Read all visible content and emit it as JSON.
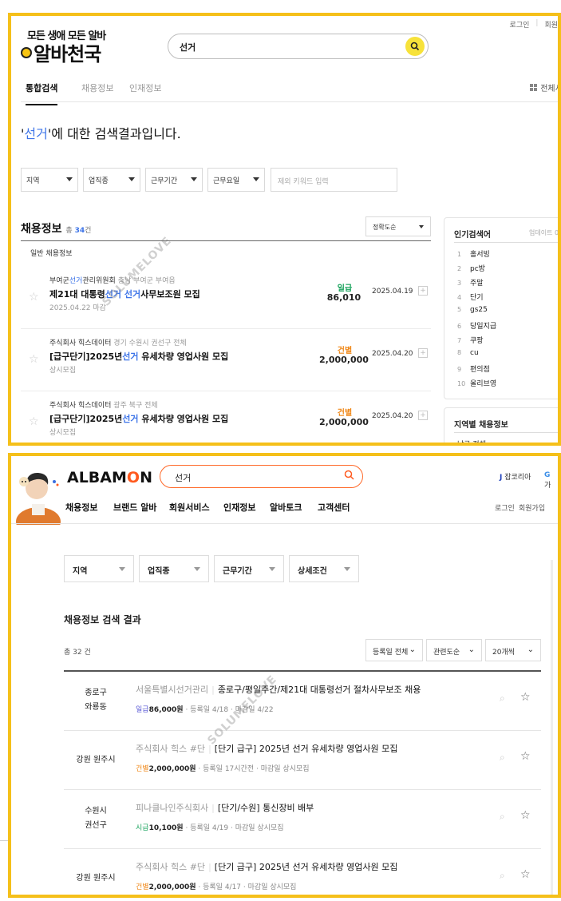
{
  "watermark": "SOLUMELOVE",
  "top": {
    "top_links": [
      "로그인",
      "회원"
    ],
    "logo_tagline": "모든 생애 모든 알바",
    "logo_name": "알바천국",
    "search_query": "선거",
    "tabs": [
      "통합검색",
      "채용정보",
      "인재정보"
    ],
    "tabs_right": "전체서비",
    "result_keyword": "선거",
    "result_suffix": "에 대한 검색결과입니다.",
    "filters": [
      "지역",
      "업직종",
      "근무기간",
      "근무요일"
    ],
    "keyword_placeholder": "제외 키워드 입력",
    "jobs_label": "채용정보",
    "jobs_count_prefix": "총",
    "jobs_count": "34",
    "jobs_count_suffix": "건",
    "sort": "정확도순",
    "general_label": "일반 채용정보",
    "rows": [
      {
        "company_pre": "부여군",
        "company_kw": "선거",
        "company_post": "관리위원회",
        "location": "충남 부여군 부여읍",
        "title_pre": "제21대 대통령",
        "title_kw1": "선거",
        "title_mid": " ",
        "title_kw2": "선거",
        "title_post": "사무보조원 모집",
        "sub": "2025.04.22 마감",
        "pay_type": "일급",
        "pay_color": "#19a35c",
        "pay_amount": "86,010",
        "date": "2025.04.19"
      },
      {
        "company_pre": "주식회사 힉스데이터",
        "company_kw": "",
        "company_post": "",
        "location": "경기 수원시 권선구 전체",
        "title_pre": "[급구단기]2025년",
        "title_kw1": "선거",
        "title_mid": "",
        "title_kw2": "",
        "title_post": " 유세차량 영업사원 모집",
        "sub": "상시모집",
        "pay_type": "건별",
        "pay_color": "#f08a1c",
        "pay_amount": "2,000,000",
        "date": "2025.04.20"
      },
      {
        "company_pre": "주식회사 힉스데이터",
        "company_kw": "",
        "company_post": "",
        "location": "광주 북구 전체",
        "title_pre": "[급구단기]2025년",
        "title_kw1": "선거",
        "title_mid": "",
        "title_kw2": "",
        "title_post": " 유세차량 영업사원 모집",
        "sub": "상시모집",
        "pay_type": "건별",
        "pay_color": "#f08a1c",
        "pay_amount": "2,000,000",
        "date": "2025.04.20"
      }
    ],
    "popular_title": "인기검색어",
    "popular_updated": "업데이트 04",
    "popular": [
      {
        "rank": "1",
        "term": "홀서빙"
      },
      {
        "rank": "2",
        "term": "pc방"
      },
      {
        "rank": "3",
        "term": "주말"
      },
      {
        "rank": "4",
        "term": "단기"
      },
      {
        "rank": "5",
        "term": "gs25"
      },
      {
        "rank": "6",
        "term": "당일지급"
      },
      {
        "rank": "7",
        "term": "쿠팡"
      },
      {
        "rank": "8",
        "term": "cu"
      },
      {
        "rank": "9",
        "term": "편의점"
      },
      {
        "rank": "10",
        "term": "올리브영"
      }
    ],
    "region_title": "지역별 채용정보",
    "region_item": "남구 전체"
  },
  "bottom": {
    "logo_pre": "ALBAM",
    "logo_o": "O",
    "logo_post": "N",
    "search_query": "선거",
    "partners": [
      {
        "badge": "J",
        "name": "잡코리아",
        "color": "#1d3fbb"
      },
      {
        "badge": "G",
        "name": "가",
        "color": "#3b8ee8"
      }
    ],
    "nav": [
      "채용정보",
      "브랜드 알바",
      "회원서비스",
      "인재정보",
      "알바토크",
      "고객센터"
    ],
    "nav_right": [
      "로그인",
      "회원가입"
    ],
    "filters": [
      "지역",
      "업직종",
      "근무기간",
      "상세조건"
    ],
    "result_title": "채용정보 검색 결과",
    "result_count": "총 32 건",
    "sorts": [
      "등록일 전체",
      "관련도순",
      "20개씩"
    ],
    "rows": [
      {
        "loc1": "종로구",
        "loc2": "와룡동",
        "company": "서울특별시선거관리",
        "title": "종로구/평일주간/제21대 대통령선거 절차사무보조 채용",
        "pay_type": "일급",
        "pay_color": "#5a5ad6",
        "pay": "86,000원",
        "reg": "등록일 4/18",
        "deadline": "마감일 4/22"
      },
      {
        "loc1": "강원 원주시",
        "loc2": "",
        "company": "주식회사 힉스 #단",
        "title": "[단기 급구] 2025년 선거 유세차량 영업사원 모집",
        "pay_type": "건별",
        "pay_color": "#f08a1c",
        "pay": "2,000,000원",
        "reg": "등록일 17시간전",
        "deadline": "마감일 상시모집"
      },
      {
        "loc1": "수원시",
        "loc2": "권선구",
        "company": "피나클나인주식회사",
        "title": "[단기/수원] 통신장비 배부",
        "pay_type": "시급",
        "pay_color": "#19a35c",
        "pay": "10,100원",
        "reg": "등록일 4/19",
        "deadline": "마감일 상시모집"
      },
      {
        "loc1": "강원 원주시",
        "loc2": "",
        "company": "주식회사 힉스 #단",
        "title": "[단기 급구] 2025년 선거 유세차량 영업사원 모집",
        "pay_type": "건별",
        "pay_color": "#f08a1c",
        "pay": "2,000,000원",
        "reg": "등록일 4/17",
        "deadline": "마감일 상시모집"
      }
    ]
  }
}
